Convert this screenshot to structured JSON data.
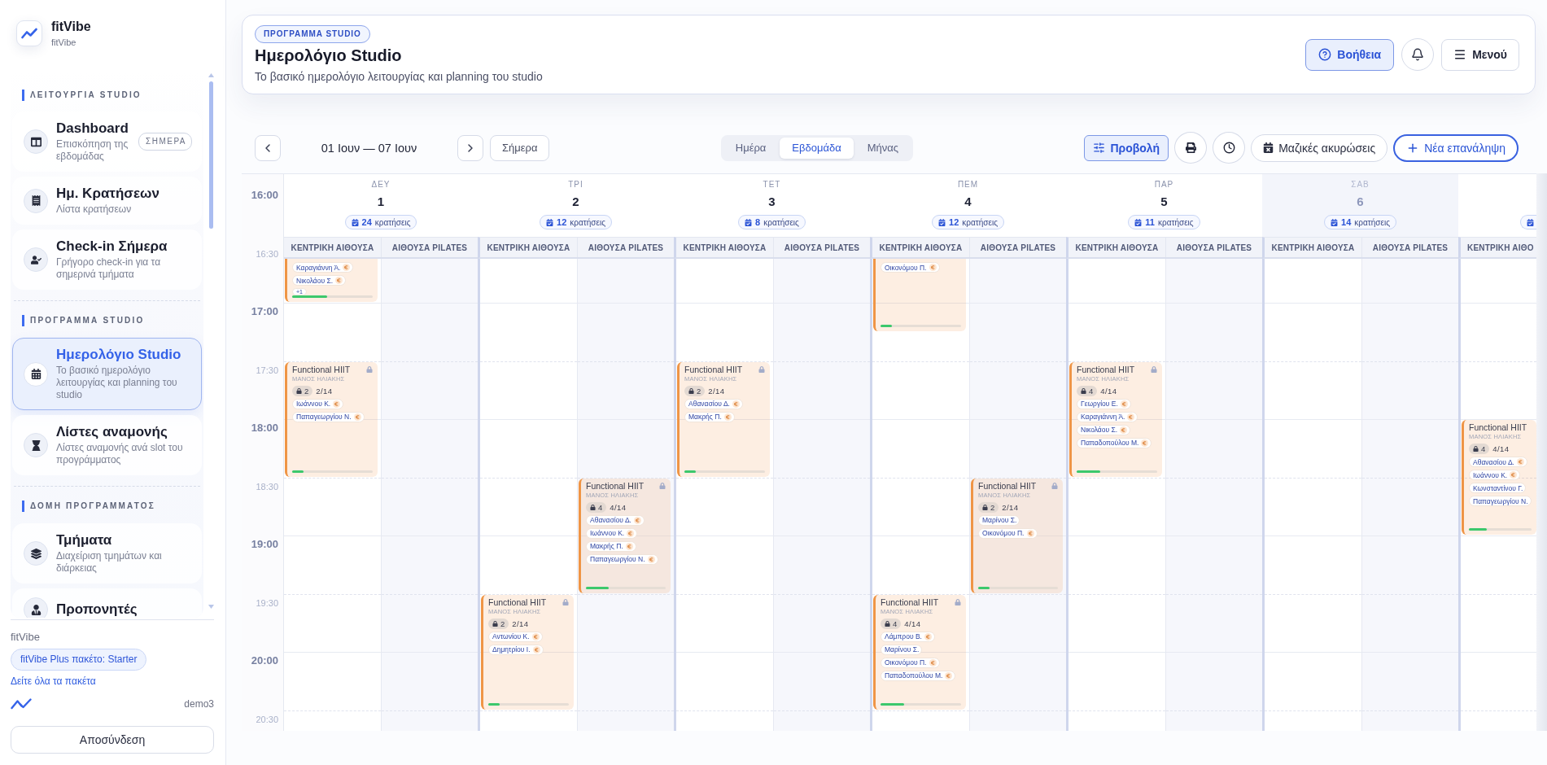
{
  "sidebar": {
    "brand": {
      "name": "fitVibe",
      "tagline": "fitVibe"
    },
    "sections": [
      {
        "title": "ΛΕΙΤΟΥΡΓΙΑ STUDIO",
        "items": [
          {
            "title": "Dashboard",
            "subtitle": "Επισκόπηση της εβδομάδας",
            "badge": "ΣΗΜΕΡΑ",
            "selected": false
          },
          {
            "title": "Ημ. Κρατήσεων",
            "subtitle": "Λίστα κρατήσεων",
            "selected": false
          },
          {
            "title": "Check-in Σήμερα",
            "subtitle": "Γρήγορο check-in για τα σημερινά τμήματα",
            "selected": false
          }
        ]
      },
      {
        "title": "ΠΡΟΓΡΑΜΜΑ STUDIO",
        "items": [
          {
            "title": "Ημερολόγιο Studio",
            "subtitle": "Το βασικό ημερολόγιο λειτουργίας και planning του studio",
            "selected": true
          },
          {
            "title": "Λίστες αναμονής",
            "subtitle": "Λίστες αναμονής ανά slot του προγράμματος",
            "selected": false
          }
        ]
      },
      {
        "title": "ΔΟΜΗ ΠΡΟΓΡΑΜΜΑΤΟΣ",
        "items": [
          {
            "title": "Τμήματα",
            "subtitle": "Διαχείριση τμημάτων και διάρκειας",
            "selected": false
          },
          {
            "title": "Προπονητές",
            "selected": false
          }
        ]
      }
    ],
    "footer": {
      "organization": "fitVibe",
      "plan": "fitVibe Plus πακέτο: Starter",
      "plans_link": "Δείτε όλα τα πακέτα",
      "user": "demo3",
      "logout": "Αποσύνδεση"
    }
  },
  "header": {
    "eyebrow": "ΠΡΟΓΡΑΜΜΑ STUDIO",
    "title": "Ημερολόγιο Studio",
    "subtitle": "Το βασικό ημερολόγιο λειτουργίας και planning του studio",
    "actions": [
      {
        "kind": "primary",
        "label": "Βοήθεια"
      },
      {
        "kind": "icon"
      },
      {
        "kind": "plain",
        "label": "Μενού"
      }
    ]
  },
  "toolbar": {
    "range": "01 Ιουν — 07 Ιουν",
    "today": "Σήμερα",
    "views": [
      {
        "label": "Ημέρα",
        "selected": false
      },
      {
        "label": "Εβδομάδα",
        "selected": true
      },
      {
        "label": "Μήνας",
        "selected": false
      }
    ],
    "actions": [
      {
        "kind": "toggle",
        "label": "Προβολή",
        "active": true
      },
      {
        "kind": "icon"
      },
      {
        "kind": "icon"
      },
      {
        "kind": "outline",
        "label": "Μαζικές ακυρώσεις"
      },
      {
        "kind": "primary",
        "label": "Νέα επανάληψη"
      }
    ]
  },
  "calendar": {
    "times": [
      {
        "label": "16:00",
        "major": true
      },
      {
        "label": "16:30",
        "major": false
      },
      {
        "label": "17:00",
        "major": true
      },
      {
        "label": "17:30",
        "major": false
      },
      {
        "label": "18:00",
        "major": true
      },
      {
        "label": "18:30",
        "major": false
      },
      {
        "label": "19:00",
        "major": true
      },
      {
        "label": "19:30",
        "major": false
      },
      {
        "label": "20:00",
        "major": true
      },
      {
        "label": "20:30",
        "major": false
      }
    ],
    "days": [
      {
        "kind": "full",
        "weekday": "ΔΕΥ",
        "date": "1",
        "bookings": "24",
        "bookings_label": "κρατήσεις",
        "muted": false,
        "rooms": [
          {
            "label": "ΚΕΝΤΡΙΚΗ ΑΙΘΟΥΣΑ",
            "events": [
              {
                "attendees": [
                  {
                    "name": "Καραγιάννη Ά.",
                    "pending": true
                  },
                  {
                    "name": "Νικολάου Σ.",
                    "pending": true
                  }
                ],
                "more": "+1",
                "level": 0.43
              },
              {
                "title": "Functional HIIT",
                "trainer": "ΜΑΝΟΣ ΗΛΙΑΚΗΣ",
                "locked": true,
                "held": "2",
                "booked": "2/14",
                "attendees": [
                  {
                    "name": "Ιωάννου Κ.",
                    "pending": true
                  },
                  {
                    "name": "Παπαγεωργίου Ν.",
                    "pending": true
                  }
                ],
                "level": 0.14
              }
            ]
          },
          {
            "label": "ΑΙΘΟΥΣΑ PILATES"
          }
        ]
      },
      {
        "kind": "full",
        "weekday": "ΤΡΙ",
        "date": "2",
        "bookings": "12",
        "bookings_label": "κρατήσεις",
        "muted": false,
        "rooms": [
          {
            "label": "ΚΕΝΤΡΙΚΗ ΑΙΘΟΥΣΑ",
            "events": [
              {
                "title": "Functional HIIT",
                "trainer": "ΜΑΝΟΣ ΗΛΙΑΚΗΣ",
                "locked": true,
                "held": "2",
                "booked": "2/14",
                "attendees": [
                  {
                    "name": "Αντωνίου Κ.",
                    "pending": true
                  },
                  {
                    "name": "Δημητρίου Ι.",
                    "pending": true
                  }
                ],
                "level": 0.14
              }
            ]
          },
          {
            "label": "ΑΙΘΟΥΣΑ PILATES",
            "events": [
              {
                "title": "Functional HIIT",
                "trainer": "ΜΑΝΟΣ ΗΛΙΑΚΗΣ",
                "locked": true,
                "held": "4",
                "booked": "4/14",
                "attendees": [
                  {
                    "name": "Αθανασίου Δ.",
                    "pending": true
                  },
                  {
                    "name": "Ιωάννου Κ.",
                    "pending": true
                  },
                  {
                    "name": "Μακρής Π.",
                    "pending": true
                  },
                  {
                    "name": "Παπαγεωργίου Ν.",
                    "pending": true
                  }
                ],
                "level": 0.29
              }
            ]
          }
        ]
      },
      {
        "kind": "full",
        "weekday": "ΤΕΤ",
        "date": "3",
        "bookings": "8",
        "bookings_label": "κρατήσεις",
        "muted": false,
        "rooms": [
          {
            "label": "ΚΕΝΤΡΙΚΗ ΑΙΘΟΥΣΑ",
            "events": [
              {
                "title": "Functional HIIT",
                "trainer": "ΜΑΝΟΣ ΗΛΙΑΚΗΣ",
                "locked": true,
                "held": "2",
                "booked": "2/14",
                "attendees": [
                  {
                    "name": "Αθανασίου Δ.",
                    "pending": true
                  },
                  {
                    "name": "Μακρής Π.",
                    "pending": true
                  }
                ],
                "level": 0.14
              }
            ]
          },
          {
            "label": "ΑΙΘΟΥΣΑ PILATES"
          }
        ]
      },
      {
        "kind": "full",
        "weekday": "ΠΕΜ",
        "date": "4",
        "bookings": "12",
        "bookings_label": "κρατήσεις",
        "muted": false,
        "rooms": [
          {
            "label": "ΚΕΝΤΡΙΚΗ ΑΙΘΟΥΣΑ",
            "events": [
              {
                "attendees": [
                  {
                    "name": "Οικονόμου Π.",
                    "pending": true
                  }
                ],
                "level": 0.14
              },
              {
                "title": "Functional HIIT",
                "trainer": "ΜΑΝΟΣ ΗΛΙΑΚΗΣ",
                "locked": true,
                "held": "4",
                "booked": "4/14",
                "attendees": [
                  {
                    "name": "Λάμπρου Β.",
                    "pending": true
                  },
                  {
                    "name": "Μαρίνου Σ.",
                    "pending": false
                  },
                  {
                    "name": "Οικονόμου Π.",
                    "pending": true
                  },
                  {
                    "name": "Παπαδοπούλου Μ.",
                    "pending": true
                  }
                ],
                "level": 0.29
              }
            ]
          },
          {
            "label": "ΑΙΘΟΥΣΑ PILATES",
            "events": [
              {
                "title": "Functional HIIT",
                "trainer": "ΜΑΝΟΣ ΗΛΙΑΚΗΣ",
                "locked": true,
                "held": "2",
                "booked": "2/14",
                "attendees": [
                  {
                    "name": "Μαρίνου Σ.",
                    "pending": false
                  },
                  {
                    "name": "Οικονόμου Π.",
                    "pending": true
                  }
                ],
                "level": 0.14
              }
            ]
          }
        ]
      },
      {
        "kind": "full",
        "weekday": "ΠΑΡ",
        "date": "5",
        "bookings": "11",
        "bookings_label": "κρατήσεις",
        "muted": false,
        "rooms": [
          {
            "label": "ΚΕΝΤΡΙΚΗ ΑΙΘΟΥΣΑ",
            "events": [
              {
                "title": "Functional HIIT",
                "trainer": "ΜΑΝΟΣ ΗΛΙΑΚΗΣ",
                "locked": true,
                "held": "4",
                "booked": "4/14",
                "attendees": [
                  {
                    "name": "Γεωργίου Ε.",
                    "pending": true
                  },
                  {
                    "name": "Καραγιάννη Ά.",
                    "pending": true
                  },
                  {
                    "name": "Νικολάου Σ.",
                    "pending": true
                  },
                  {
                    "name": "Παπαδοπούλου Μ.",
                    "pending": true
                  }
                ],
                "level": 0.29
              }
            ]
          },
          {
            "label": "ΑΙΘΟΥΣΑ PILATES"
          }
        ]
      },
      {
        "kind": "full",
        "weekday": "ΣΑΒ",
        "date": "6",
        "bookings": "14",
        "bookings_label": "κρατήσεις",
        "muted": true,
        "rooms": [
          {
            "label": "ΚΕΝΤΡΙΚΗ ΑΙΘΟΥΣΑ"
          },
          {
            "label": "ΑΙΘΟΥΣΑ PILATES"
          }
        ]
      },
      {
        "kind": "cut",
        "muted": false,
        "rooms": [
          {
            "label": "ΚΕΝΤΡΙΚΗ ΑΙΘΟ",
            "events": [
              {
                "title": "Functional HIIT",
                "trainer": "ΜΑΝΟΣ ΗΛΙΑΚΗΣ",
                "locked": false,
                "held": "4",
                "booked": "4/14",
                "attendees": [
                  {
                    "name": "Αθανασίου Δ.",
                    "pending": true
                  },
                  {
                    "name": "Ιωάννου Κ.",
                    "pending": true
                  },
                  {
                    "name": "Κωνσταντίνου Γ.",
                    "pending": false
                  },
                  {
                    "name": "Παπαγεωργίου Ν.",
                    "pending": false
                  }
                ],
                "level": 0.29
              }
            ]
          }
        ]
      }
    ]
  }
}
